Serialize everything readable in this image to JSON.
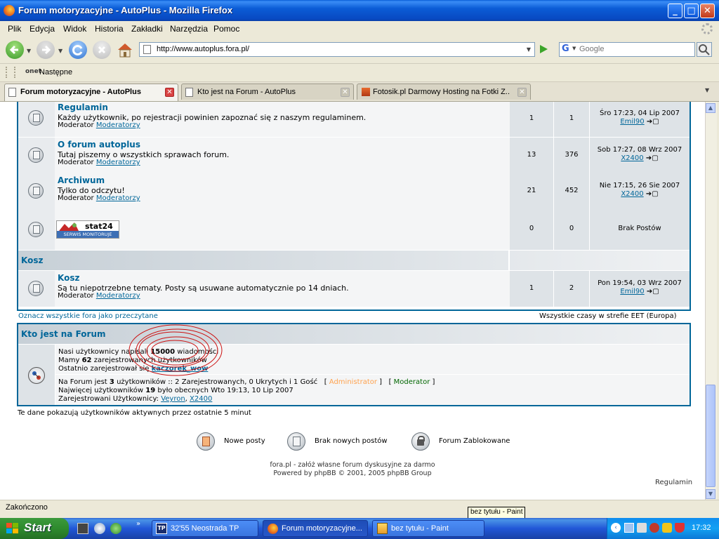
{
  "window": {
    "title": "Forum motoryzacyjne - AutoPlus - Mozilla Firefox",
    "minimize": "_",
    "maximize": "□",
    "close": "✕"
  },
  "menu": [
    "Plik",
    "Edycja",
    "Widok",
    "Historia",
    "Zakładki",
    "Narzędzia",
    "Pomoc"
  ],
  "nav": {
    "url": "http://www.autoplus.fora.pl/",
    "search_engine": "G",
    "search_placeholder": "Google"
  },
  "bookmarks": {
    "onet_logo": "onet",
    "next_label": "Następne"
  },
  "tabs": [
    {
      "label": "Forum motoryzacyjne - AutoPlus",
      "active": true
    },
    {
      "label": "Kto jest na Forum - AutoPlus",
      "active": false
    },
    {
      "label": "Fotosik.pl Darmowy Hosting na Fotki Z...",
      "active": false
    }
  ],
  "forums": [
    {
      "name": "Regulamin",
      "desc": "Każdy użytkownik, po rejestracji powinien zapoznać się z naszym regulaminem.",
      "mod_label": "Moderator",
      "mod": "Moderatorzy",
      "topics": "1",
      "posts": "1",
      "last_date": "Śro 17:23, 04 Lip 2007",
      "last_user": "Emil90"
    },
    {
      "name": "O forum autoplus",
      "desc": "Tutaj piszemy o wszystkich sprawach forum.",
      "mod_label": "Moderator",
      "mod": "Moderatorzy",
      "topics": "13",
      "posts": "376",
      "last_date": "Sob 17:27, 08 Wrz 2007",
      "last_user": "X2400"
    },
    {
      "name": "Archiwum",
      "desc": "Tylko do odczytu!",
      "mod_label": "Moderator",
      "mod": "Moderatorzy",
      "topics": "21",
      "posts": "452",
      "last_date": "Nie 17:15, 26 Sie 2007",
      "last_user": "X2400"
    }
  ],
  "stat_row": {
    "logo": "stat24",
    "logo_sub": "SERWIS MONITORUJE",
    "topics": "0",
    "posts": "0",
    "last": "Brak Postów"
  },
  "category": "Kosz",
  "trash": {
    "name": "Kosz",
    "desc": "Są tu niepotrzebne tematy. Posty są usuwane automatycznie po 14 dniach.",
    "mod_label": "Moderator",
    "mod": "Moderatorzy",
    "topics": "1",
    "posts": "2",
    "last_date": "Pon 19:54, 03 Wrz 2007",
    "last_user": "Emil90"
  },
  "mark_read": "Oznacz wszystkie fora jako przeczytane",
  "timezone": "Wszystkie czasy w strefie EET (Europa)",
  "who": {
    "title": "Kto jest na Forum",
    "l1a": "Nasi użytkownicy napisali ",
    "l1b": "15000",
    "l1c": " wiadomości",
    "l2a": "Mamy ",
    "l2b": "62",
    "l2c": " zarejestrowanych użytkowników",
    "l3a": "Ostatnio zarejestrował się ",
    "l3b": "kaczorek_wow",
    "l4a": "Na Forum jest ",
    "l4b": "3",
    "l4c": " użytkowników :: 2 Zarejestrowanych, 0 Ukrytych i 1 Gość",
    "admin": "Administrator",
    "moderator": "Moderator",
    "l5a": "Najwięcej użytkowników ",
    "l5b": "19",
    "l5c": " było obecnych Wto 19:13, 10 Lip 2007",
    "l6a": "Zarejestrowani Użytkownicy: ",
    "u1": "Veyron",
    "u2": "X2400"
  },
  "active_note": "Te dane pokazują użytkowników aktywnych przez ostatnie 5 minut",
  "legend": {
    "new": "Nowe posty",
    "none": "Brak nowych postów",
    "locked": "Forum Zablokowane"
  },
  "footer": {
    "line1": "fora.pl - załóż własne forum dyskusyjne za darmo",
    "line2": "Powered by phpBB © 2001, 2005 phpBB Group",
    "rules": "Regulamin"
  },
  "status": "Zakończono",
  "tooltip": "bez tytułu - Paint",
  "taskbar": {
    "start": "Start",
    "tasks": [
      {
        "label": "32'55 Neostrada TP",
        "active": false
      },
      {
        "label": "Forum motoryzacyjne...",
        "active": true
      },
      {
        "label": "bez tytułu - Paint",
        "active": false
      }
    ],
    "clock": "17:32"
  },
  "colors": {
    "link": "#006699",
    "admin": "#FFA34F",
    "moderator": "#006600",
    "annotation": "#CC1010"
  }
}
